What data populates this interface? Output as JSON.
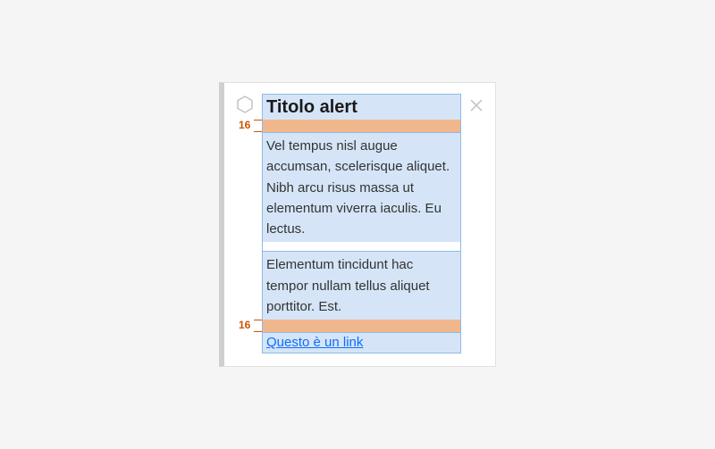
{
  "alert": {
    "title": "Titolo alert",
    "body1": "Vel tempus nisl augue accumsan, scelerisque aliquet. Nibh arcu risus massa ut elementum viverra iaculis. Eu lectus.",
    "body2": "Elementum tincidunt hac tempor nullam tellus aliquet porttitor. Est.",
    "link_text": "Questo è un link"
  },
  "spacing": {
    "top_value": "16",
    "bottom_value": "16"
  }
}
